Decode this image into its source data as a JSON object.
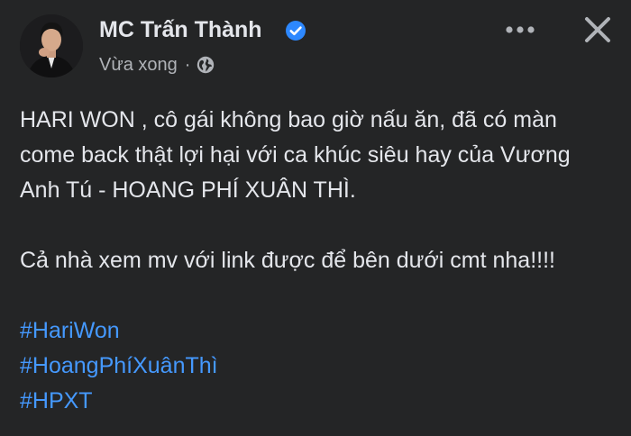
{
  "post": {
    "author_name": "MC Trấn Thành",
    "timestamp": "Vừa xong",
    "separator": "·",
    "privacy_icon": "globe-icon",
    "verified_icon": "verified-badge-icon",
    "more_icon": "more-horizontal-icon",
    "close_icon": "close-icon",
    "content": {
      "paragraph_1": "HARI WON , cô gái không bao giờ nấu ăn, đã có màn come back thật lợi hại với ca khúc siêu hay của Vương Anh Tú - HOANG PHÍ XUÂN THÌ.",
      "paragraph_2": "Cả nhà xem mv với link được để bên dưới cmt nha!!!!",
      "hashtags": [
        "#HariWon",
        "#HoangPhíXuânThì",
        "#HPXT"
      ]
    }
  },
  "colors": {
    "background": "#242526",
    "primary_text": "#e4e6eb",
    "secondary_text": "#b0b3b8",
    "link": "#4599ff",
    "verified_badge": "#2d88ff"
  }
}
